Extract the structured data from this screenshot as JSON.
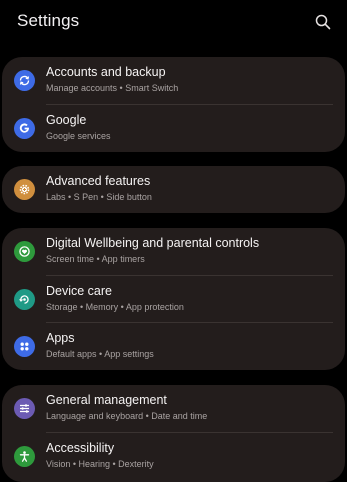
{
  "header": {
    "title": "Settings",
    "search_icon": "search-icon"
  },
  "groups": [
    {
      "items": [
        {
          "title": "Accounts and backup",
          "subtitle": "Manage accounts  •  Smart Switch",
          "icon": "sync-icon",
          "icon_color": "#3e6be6"
        },
        {
          "title": "Google",
          "subtitle": "Google services",
          "icon": "google-icon",
          "icon_color": "#3e6be6"
        }
      ]
    },
    {
      "items": [
        {
          "title": "Advanced features",
          "subtitle": "Labs  •  S Pen  •  Side button",
          "icon": "gear-plus-icon",
          "icon_color": "#d08f3e"
        }
      ]
    },
    {
      "items": [
        {
          "title": "Digital Wellbeing and parental controls",
          "subtitle": "Screen time  •  App timers",
          "icon": "wellbeing-heart-icon",
          "icon_color": "#2e9a3c"
        },
        {
          "title": "Device care",
          "subtitle": "Storage  •  Memory  •  App protection",
          "icon": "device-care-icon",
          "icon_color": "#1f9a86"
        },
        {
          "title": "Apps",
          "subtitle": "Default apps  •  App settings",
          "icon": "apps-grid-icon",
          "icon_color": "#3e6be6"
        }
      ]
    },
    {
      "items": [
        {
          "title": "General management",
          "subtitle": "Language and keyboard  •  Date and time",
          "icon": "sliders-icon",
          "icon_color": "#6c5bb3"
        },
        {
          "title": "Accessibility",
          "subtitle": "Vision  •  Hearing  •  Dexterity",
          "icon": "accessibility-icon",
          "icon_color": "#2e9a3c"
        }
      ]
    }
  ]
}
